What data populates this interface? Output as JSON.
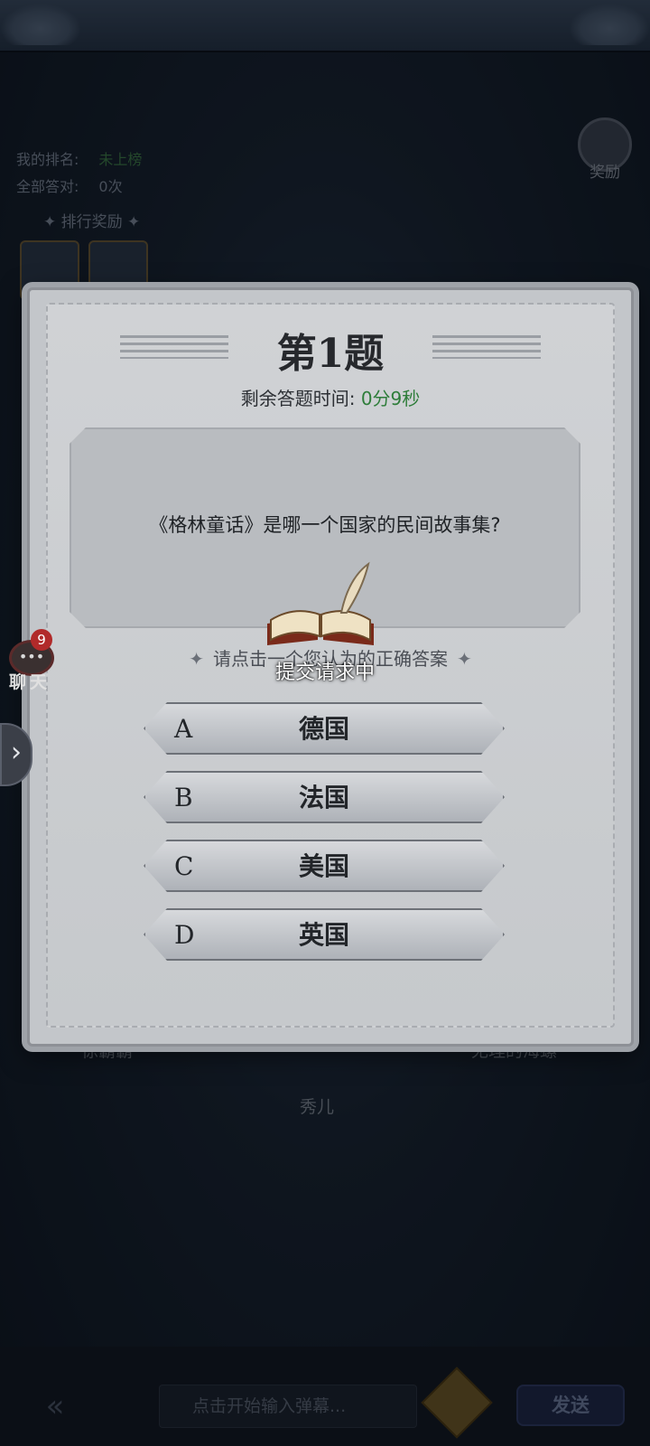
{
  "stats": {
    "my_rank_label": "我的排名:",
    "my_rank_value": "未上榜",
    "all_correct_label": "全部答对:",
    "all_correct_value": "0次",
    "rank_reward_label": "排行奖励"
  },
  "reward_button": {
    "label": "奖励"
  },
  "chat": {
    "label": "聊天",
    "badge": "9"
  },
  "players": [
    {
      "name": "徐霸霸°"
    },
    {
      "name": "无理的海螺"
    },
    {
      "name": "秀儿"
    }
  ],
  "dialog": {
    "title": "第1题",
    "timer_label": "剩余答题时间:",
    "timer_value": "0分9秒",
    "question": "《格林童话》是哪一个国家的民间故事集?",
    "hint": "请点击一个您认为的正确答案",
    "options": [
      {
        "letter": "A",
        "answer": "德国"
      },
      {
        "letter": "B",
        "answer": "法国"
      },
      {
        "letter": "C",
        "answer": "美国"
      },
      {
        "letter": "D",
        "answer": "英国"
      }
    ]
  },
  "loading": {
    "text": "提交请求中"
  },
  "bottom": {
    "danmaku_placeholder": "点击开始输入弹幕...",
    "send_label": "发送"
  },
  "colors": {
    "timer_green": "#2e7d3a",
    "badge_red": "#b12a2a",
    "dialog_bg": "#c3c6ca"
  }
}
